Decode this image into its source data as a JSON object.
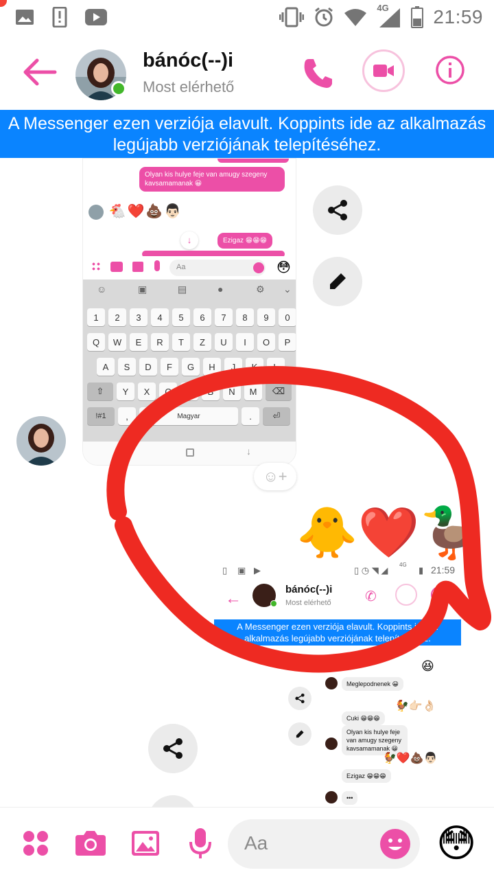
{
  "status_bar": {
    "time": "21:59",
    "network": "4G",
    "icons": [
      "image-icon",
      "sim-alert-icon",
      "youtube-icon",
      "vibrate-icon",
      "alarm-icon",
      "wifi-icon",
      "signal-icon",
      "battery-icon"
    ]
  },
  "header": {
    "contact_name": "bánóc(--)i",
    "contact_status": "Most elérhető",
    "accent_color": "#ec4fa7"
  },
  "banner": {
    "text": "A Messenger ezen verziója elavult. Koppints ide az alkalmazás legújabb verziójának telepítéséhez."
  },
  "shot1": {
    "message_1": "Olyan kis hulye feje van amugy szegeny kavsamamanak 😀",
    "emoji_row": "🐔❤️💩👨🏻",
    "message_2": "Ezigaz 😁😁😁",
    "composer_placeholder": "Aa",
    "keyboard": {
      "row_numbers": [
        "1",
        "2",
        "3",
        "4",
        "5",
        "6",
        "7",
        "8",
        "9",
        "0"
      ],
      "row_1": [
        "Q",
        "W",
        "E",
        "R",
        "T",
        "Z",
        "U",
        "I",
        "O",
        "P"
      ],
      "row_2": [
        "A",
        "S",
        "D",
        "F",
        "G",
        "H",
        "J",
        "K",
        "L"
      ],
      "row_3": [
        "Y",
        "X",
        "C",
        "V",
        "B",
        "N",
        "M"
      ],
      "symbols_key": "!#1",
      "comma_key": ",",
      "space_label": "Magyar",
      "period_key": "."
    }
  },
  "chat": {
    "big_emojis": "🐥❤️🦆",
    "reaction_add": "☺+"
  },
  "shot2": {
    "time": "21:59",
    "network": "4G",
    "contact_name": "bánóc(--)i",
    "contact_status": "Most elérhető",
    "banner_text": "A Messenger ezen verziója elavult. Koppints ide az alkalmazás legújabb verziójának telepítéséhez.",
    "messages": [
      "Meglepodnenek 😀",
      "Cuki 😁😁😁",
      "Olyan kis hulye feje van amugy szegeny kavsamamanak 😀",
      "Ezigaz 😁😁😁",
      "•••"
    ],
    "emoji_lines": [
      "😆",
      "🐓👉🏻👌🏻",
      "🐓❤️💩👨🏻"
    ]
  },
  "composer": {
    "placeholder": "Aa",
    "big_emoji": "😳"
  }
}
